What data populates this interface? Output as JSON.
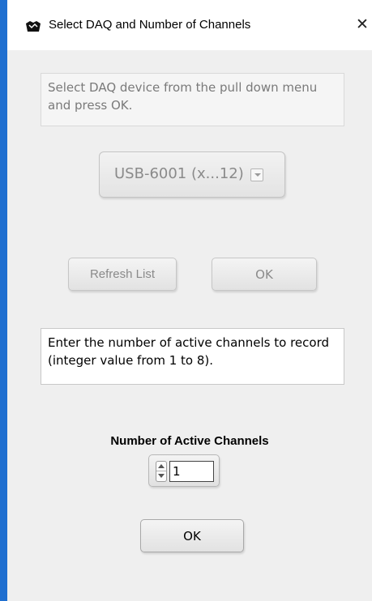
{
  "window": {
    "title": "Select DAQ and Number of Channels",
    "close_glyph": "✕",
    "app_icon": "labview-icon",
    "border_color": "#1f6fd0"
  },
  "daq_section": {
    "instruction": "Select DAQ device from the pull down menu and press OK.",
    "device_ring_value": "USB-6001  (x...12)",
    "refresh_button_label": "Refresh List",
    "ok_button_label": "OK"
  },
  "channels_section": {
    "instruction": "Enter the number of active channels to record (integer value from 1 to 8).",
    "numeric_label": "Number of Active Channels",
    "numeric_value": "1",
    "ok_button_label": "OK"
  }
}
